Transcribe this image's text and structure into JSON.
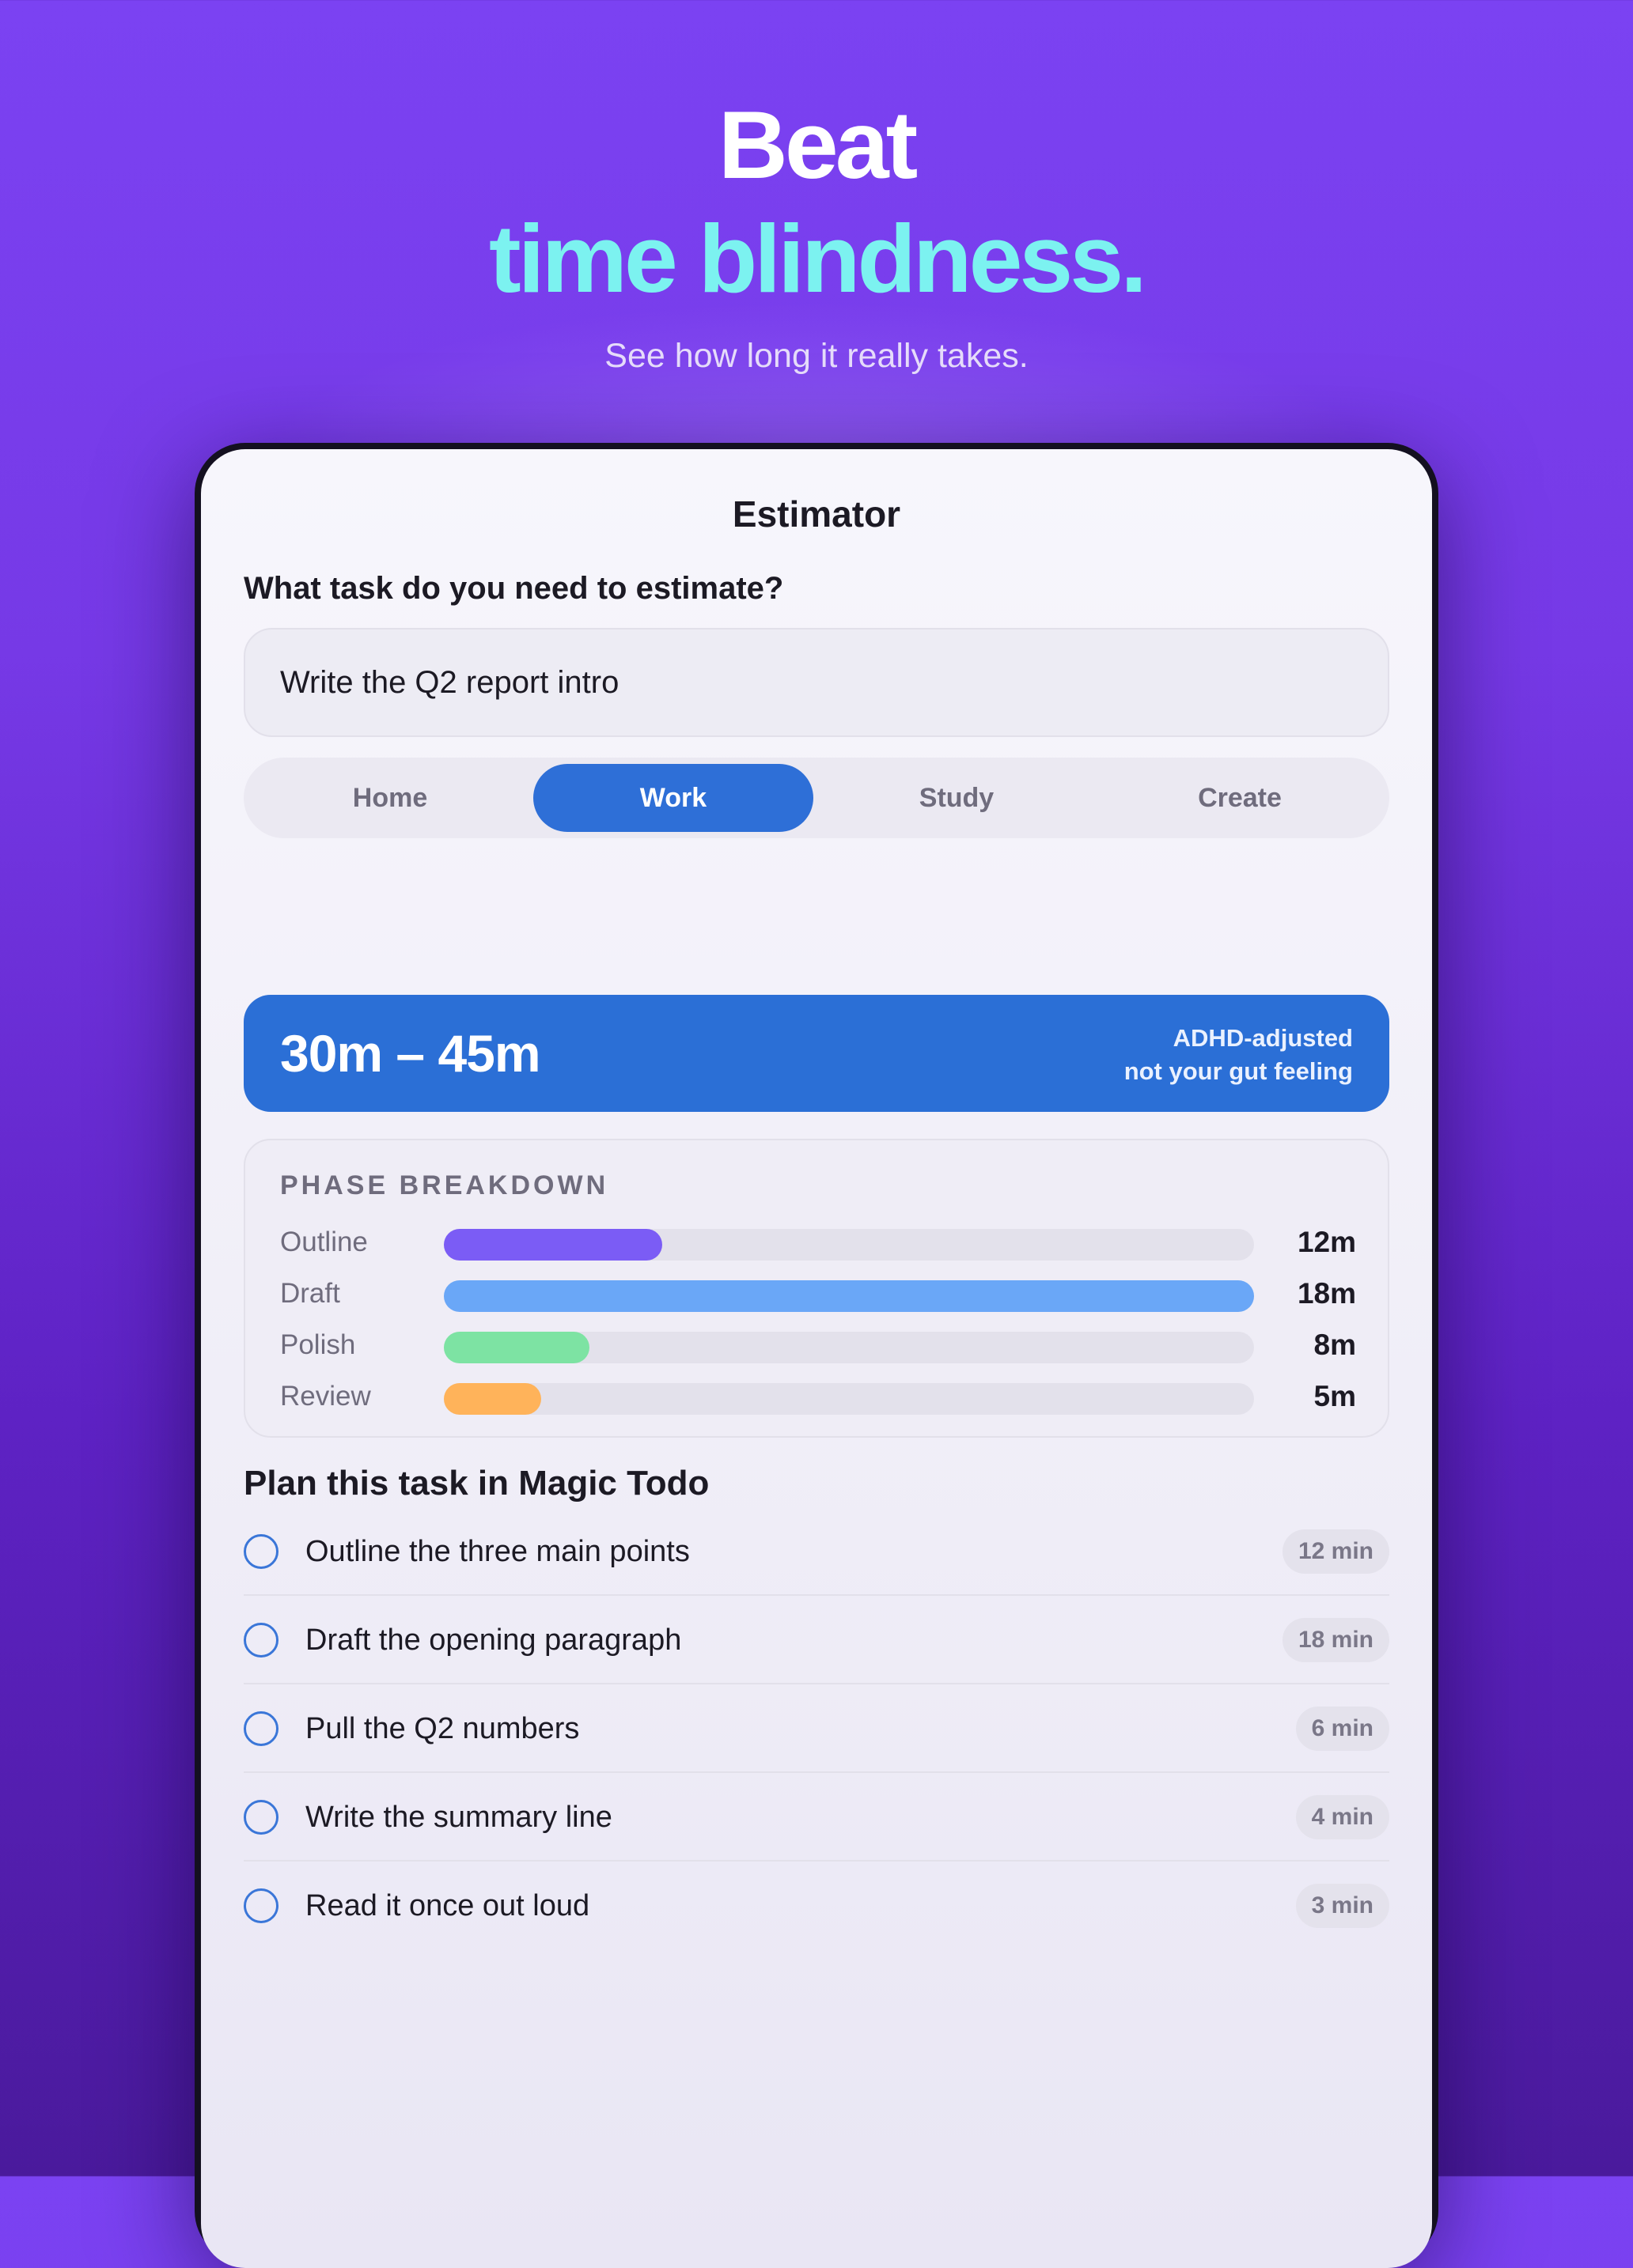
{
  "hero": {
    "title_line1": "Beat",
    "title_line2": "time blindness.",
    "subtitle": "See how long it really takes.",
    "accent_color": "#7cf2f0"
  },
  "estimator": {
    "title": "Estimator",
    "question": "What task do you need to estimate?",
    "task_value": "Write the Q2 report intro",
    "categories": [
      "Home",
      "Work",
      "Study",
      "Create"
    ],
    "selected_category": "Work",
    "estimate_range": "30m – 45m",
    "estimate_note_line1": "ADHD-adjusted",
    "estimate_note_line2": "not your gut feeling",
    "primary_color": "#2b6fd6"
  },
  "breakdown": {
    "heading": "PHASE BREAKDOWN",
    "phases": [
      {
        "label": "Outline",
        "value": "12m",
        "fraction": 0.27,
        "color": "#7b5cf5"
      },
      {
        "label": "Draft",
        "value": "18m",
        "fraction": 1.0,
        "color": "#6aa7f7"
      },
      {
        "label": "Polish",
        "value": "8m",
        "fraction": 0.18,
        "color": "#7de3a3"
      },
      {
        "label": "Review",
        "value": "5m",
        "fraction": 0.12,
        "color": "#ffb35a"
      }
    ]
  },
  "plan": {
    "title": "Plan this task in Magic Todo",
    "items": [
      {
        "label": "Outline the three main points",
        "duration": "12 min"
      },
      {
        "label": "Draft the opening paragraph",
        "duration": "18 min"
      },
      {
        "label": "Pull the Q2 numbers",
        "duration": "6 min"
      },
      {
        "label": "Write the summary line",
        "duration": "4 min"
      },
      {
        "label": "Read it once out loud",
        "duration": "3 min"
      }
    ]
  }
}
